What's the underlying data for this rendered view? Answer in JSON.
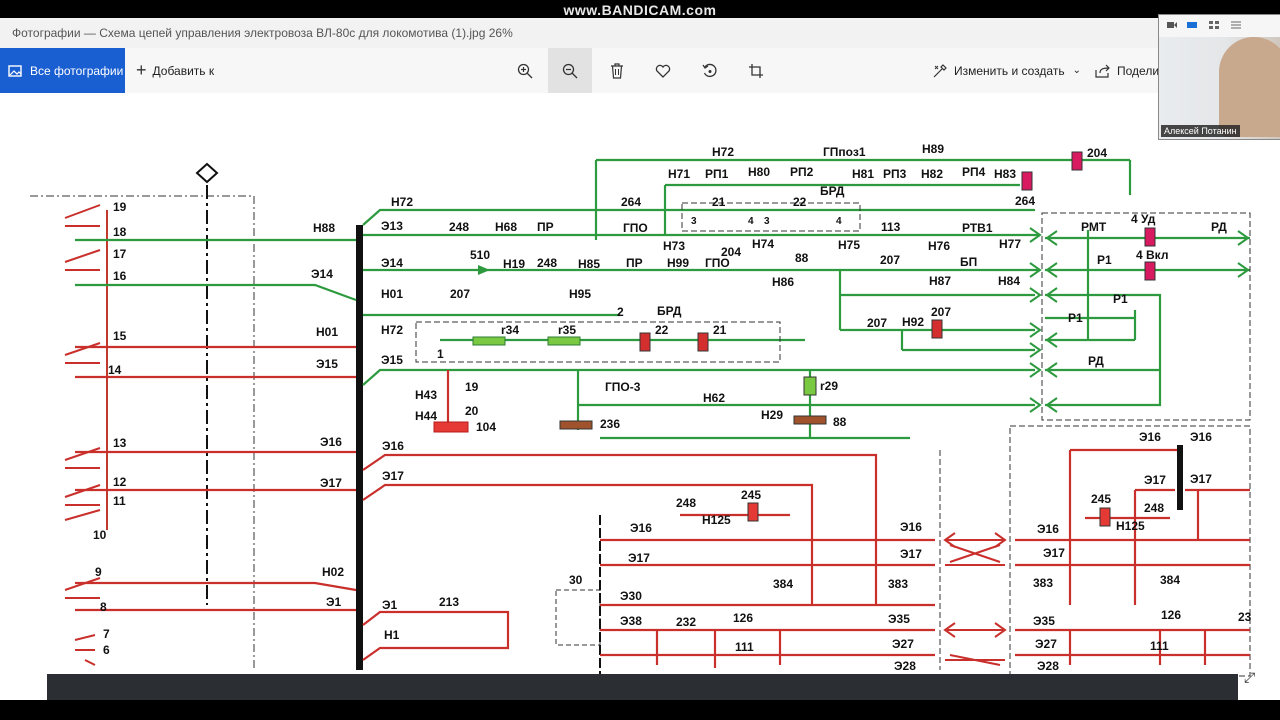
{
  "recording_watermark": "www.BANDICAM.com",
  "window": {
    "title": "Фотографии — Схема цепей управления электровоза ВЛ-80с для локомотива   (1).jpg   26%"
  },
  "toolbar": {
    "all_photos_label": "Все фотографии",
    "add_to_label": "Добавить к",
    "edit_create_label": "Изменить и создать",
    "share_label": "Подели",
    "icons": [
      "zoom-in-icon",
      "zoom-out-icon",
      "delete-icon",
      "favorite-icon",
      "rotate-icon",
      "crop-icon"
    ]
  },
  "webcam": {
    "participant_name": "Алексей Потанин"
  },
  "schematic": {
    "left_wire_labels": [
      "Н88",
      "Э14",
      "Н01",
      "Э15",
      "Э16",
      "Э17",
      "Н02",
      "Э1"
    ],
    "left_contact_numbers": [
      "19",
      "18",
      "17",
      "16",
      "15",
      "14",
      "13",
      "12",
      "11",
      "10",
      "9",
      "8",
      "7",
      "6"
    ],
    "top_labels": [
      "Н72",
      "ГПпоз1",
      "Н89",
      "204",
      "Н71",
      "РП1",
      "Н80",
      "РП2",
      "Н81",
      "РП3",
      "Н82",
      "РП4",
      "Н83",
      "БРД",
      "264",
      "21",
      "22",
      "3",
      "4",
      "3",
      "4",
      "Н72",
      "Э13",
      "248",
      "Н68",
      "ПР",
      "264",
      "ГПО",
      "Н73",
      "204",
      "Н74",
      "Н75",
      "113",
      "Н76",
      "РТВ1",
      "Н77",
      "88",
      "РМТ",
      "4 Уд",
      "РД",
      "4 Вкл",
      "Э14",
      "510",
      "Н19",
      "248",
      "Н85",
      "ПР",
      "Н99",
      "ГПО",
      "Н86",
      "207",
      "БП",
      "Н87",
      "Н84",
      "Р1",
      "Р1",
      "Р1",
      "Н01",
      "207",
      "Н95",
      "2",
      "БРД",
      "207",
      "Н92",
      "207",
      "Н72",
      "r34",
      "r35",
      "22",
      "21",
      "1",
      "Э15",
      "РД",
      "Н43",
      "19",
      "ГПО-3",
      "r29",
      "Н44",
      "20",
      "104",
      "Н62",
      "Н29",
      "236",
      "88"
    ],
    "bottom_labels": [
      "Э16",
      "Э16",
      "Э16",
      "Э17",
      "Э17",
      "Э17",
      "248",
      "245",
      "Н125",
      "Э16",
      "Э17",
      "384",
      "383",
      "30",
      "Э30",
      "Э38",
      "232",
      "126",
      "111",
      "Э35",
      "Э27",
      "Э28",
      "Э1",
      "213",
      "Н1",
      "384",
      "383",
      "Э16",
      "Э17",
      "245",
      "Н125",
      "248",
      "Э16",
      "Э17",
      "Э35",
      "Э27",
      "Э28",
      "126",
      "111",
      "23"
    ]
  }
}
